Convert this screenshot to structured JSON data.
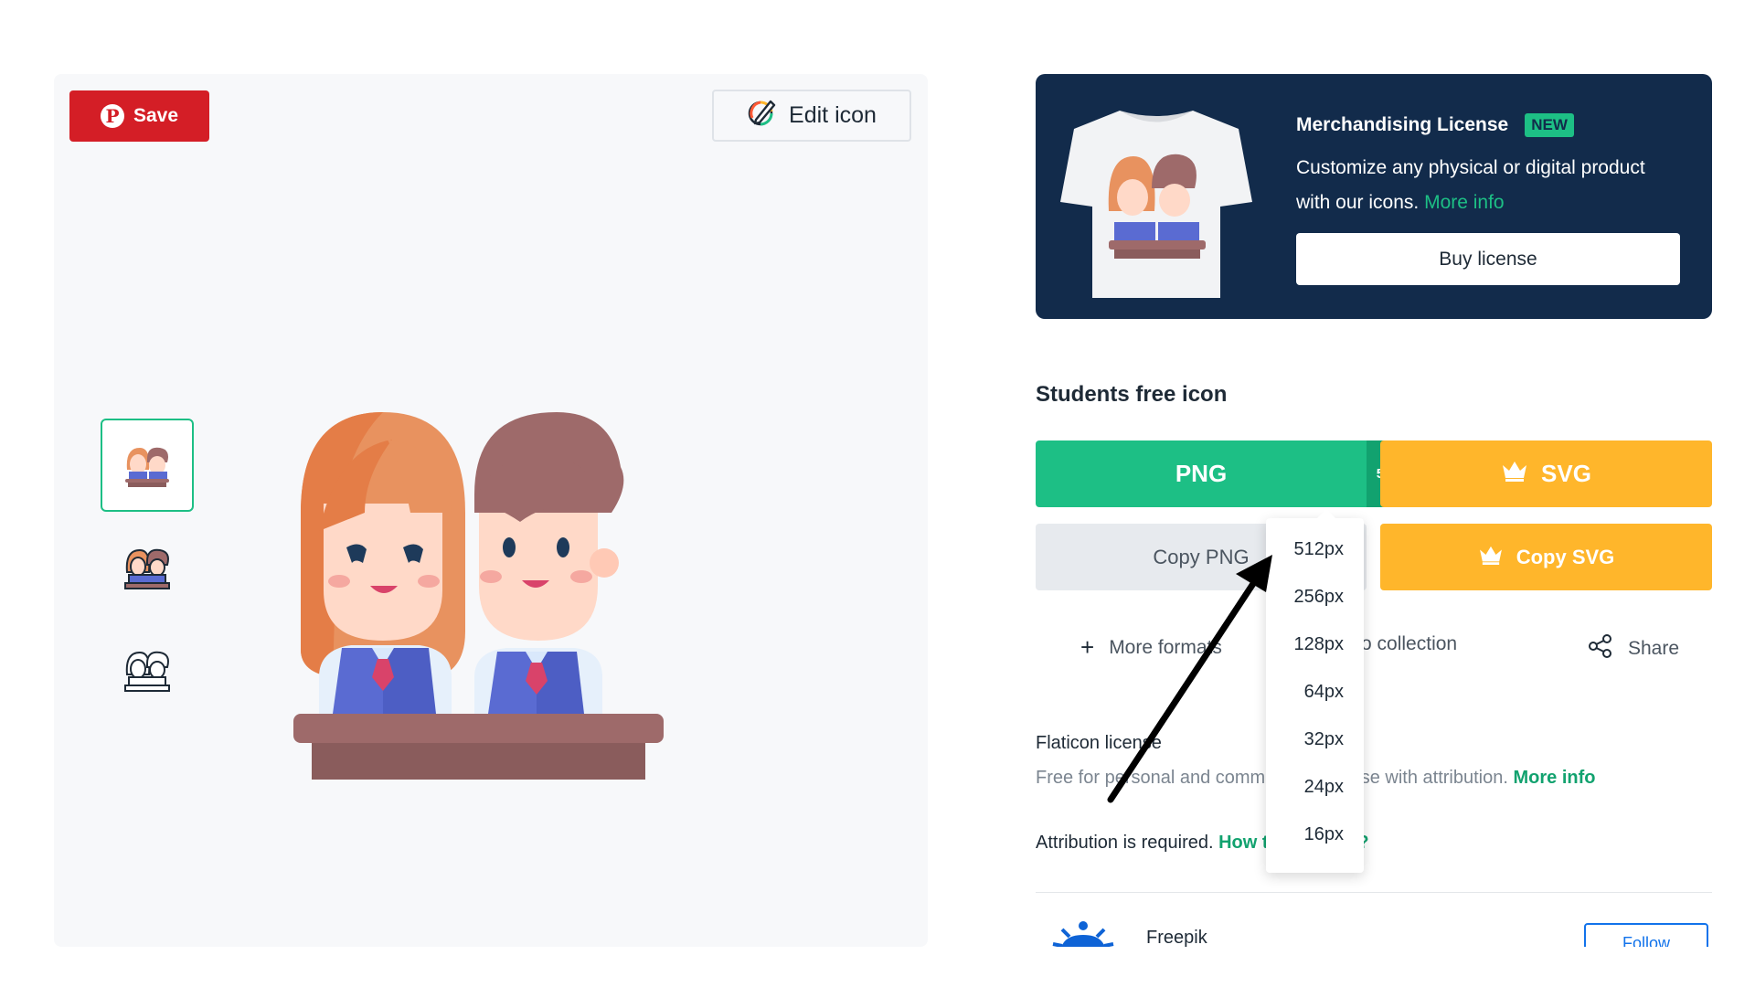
{
  "preview": {
    "save_label": "Save",
    "edit_label": "Edit icon",
    "thumbnails": [
      {
        "style": "flat"
      },
      {
        "style": "lineal-color"
      },
      {
        "style": "lineal"
      }
    ]
  },
  "merch": {
    "title": "Merchandising License",
    "badge": "NEW",
    "description": "Customize any physical or digital product with our icons.",
    "more_info": "More info",
    "buy_label": "Buy license"
  },
  "icon": {
    "title": "Students free icon"
  },
  "download": {
    "png_label": "PNG",
    "size_label": "512px",
    "svg_label": "SVG",
    "copy_png_label": "Copy PNG",
    "copy_svg_label": "Copy SVG"
  },
  "actions": {
    "more_formats": "More formats",
    "add_collection": "Add to collection",
    "share": "Share"
  },
  "license": {
    "title": "Flaticon license",
    "desc": "Free for personal and commercial purpose with attribution.",
    "more_info": "More info",
    "attribution": "Attribution is required.",
    "how_to": "How to attribute?"
  },
  "author": {
    "name": "Freepik",
    "follow": "Follow"
  },
  "size_options": [
    "512px",
    "256px",
    "128px",
    "64px",
    "32px",
    "24px",
    "16px"
  ],
  "colors": {
    "save_red": "#d41e26",
    "brand_green": "#1dbf85",
    "dark_green": "#12a26f",
    "premium_yellow": "#ffb62b",
    "navy": "#122b4b"
  }
}
